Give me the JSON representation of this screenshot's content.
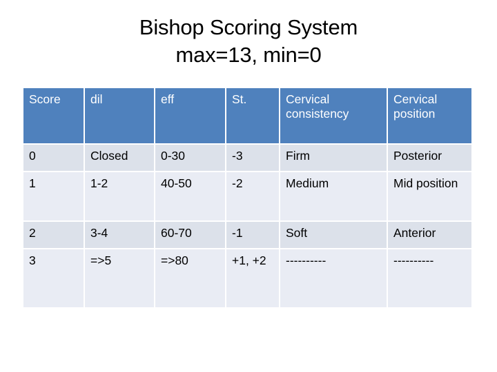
{
  "title": {
    "line1": "Bishop Scoring System",
    "line2": "max=13, min=0"
  },
  "table": {
    "headers": [
      "Score",
      "dil",
      "eff",
      "St.",
      "Cervical consistency",
      "Cervical position"
    ],
    "rows": [
      {
        "score": "0",
        "dil": "Closed",
        "eff": "0-30",
        "st": "-3",
        "consistency": "Firm",
        "position": "Posterior"
      },
      {
        "score": "1",
        "dil": "1-2",
        "eff": "40-50",
        "st": "-2",
        "consistency": "Medium",
        "position": "Mid position"
      },
      {
        "score": "2",
        "dil": "3-4",
        "eff": "60-70",
        "st": "-1",
        "consistency": "Soft",
        "position": "Anterior"
      },
      {
        "score": "3",
        "dil": "=>5",
        "eff": "=>80",
        "st": "+1, +2",
        "consistency": "----------",
        "position": "----------"
      }
    ]
  },
  "colors": {
    "header_background": "#4F81BD",
    "header_text": "#FFFFFF",
    "row_band_dark": "#DCE1EA",
    "row_band_light": "#E9ECF4",
    "body_text": "#000000",
    "page_background": "#FFFFFF",
    "gridline": "#FFFFFF"
  }
}
